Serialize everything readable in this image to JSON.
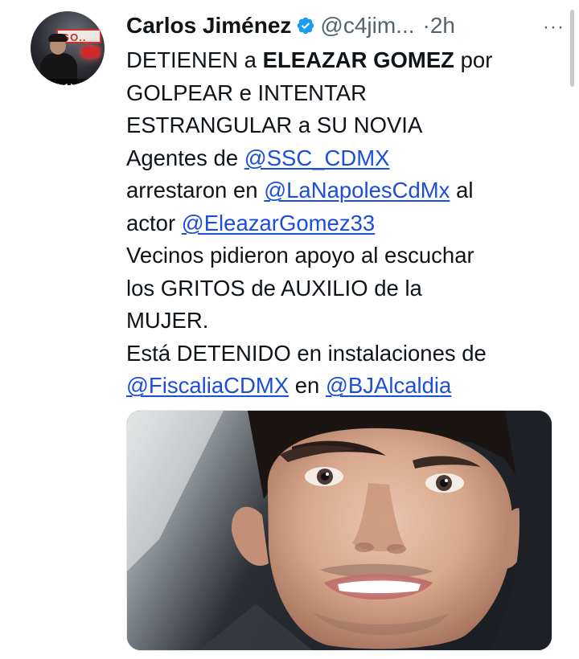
{
  "author": {
    "name": "Carlos Jiménez",
    "handle": "@c4jim...",
    "separator": "·",
    "time": "2h",
    "avatar_sign_text": "GO..",
    "avatar_controls_text": "◀◀ ◀ ▶ ▶▶ ✕"
  },
  "menu": {
    "more_label": "···"
  },
  "tweet": {
    "line1_a": "DETIENEN a ",
    "line1_b": "ELEAZAR GOMEZ",
    "line1_c": " por",
    "line2": "GOLPEAR e INTENTAR",
    "line3": "ESTRANGULAR a SU NOVIA",
    "line4_a": "Agentes de ",
    "mention_ssc": "@SSC_CDMX",
    "line5_a": "arrestaron en ",
    "mention_napoles": "@LaNapolesCdMx",
    "line5_b": " al",
    "line6_a": "actor ",
    "mention_eleazar": "@EleazarGomez33",
    "line7": "Vecinos pidieron apoyo al escuchar",
    "line8": "los GRITOS de AUXILIO de la",
    "line9": "MUJER.",
    "line10": "Está DETENIDO en instalaciones de",
    "mention_fiscalia": "@FiscaliaCDMX",
    "line11_a": " en ",
    "mention_bj": "@BJAlcaldia"
  },
  "colors": {
    "text": "#0f1419",
    "secondary": "#536471",
    "link": "#1d4ed8",
    "verified": "#1d9bf0"
  },
  "icons": {
    "verified": "verified-badge-icon",
    "more": "more-horizontal-icon"
  }
}
